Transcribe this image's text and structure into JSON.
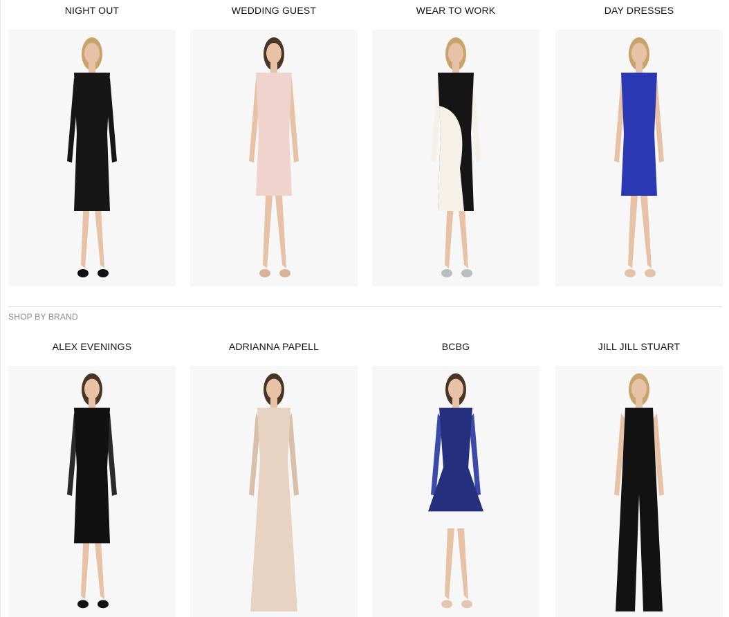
{
  "occasions": [
    {
      "label": "NIGHT OUT",
      "dress_color": "#161616",
      "accent_color": "#161616",
      "shoe_color": "#111111"
    },
    {
      "label": "WEDDING GUEST",
      "dress_color": "#efd3cc",
      "accent_color": "#f4dfd9",
      "shoe_color": "#d8b39a"
    },
    {
      "label": "WEAR TO WORK",
      "dress_color": "#151515",
      "accent_color": "#f5f1e8",
      "shoe_color": "#b7c0bc"
    },
    {
      "label": "DAY DRESSES",
      "dress_color": "#2b38b4",
      "accent_color": "#3341c2",
      "shoe_color": "#e3c3a7"
    }
  ],
  "section": {
    "heading": "SHOP BY BRAND"
  },
  "brands": [
    {
      "label": "ALEX EVENINGS",
      "dress_color": "#111111",
      "accent_color": "#2a2a2a",
      "shoe_color": "#111111"
    },
    {
      "label": "ADRIANNA PAPELL",
      "dress_color": "#e8d3c2",
      "accent_color": "#d9c0ab",
      "shoe_color": "#d9c0ab"
    },
    {
      "label": "BCBG",
      "dress_color": "#24307e",
      "accent_color": "#3b4aa8",
      "shoe_color": "#e2c6b0"
    },
    {
      "label": "JILL JILL STUART",
      "dress_color": "#121212",
      "accent_color": "#1d1d1d",
      "shoe_color": "#111111"
    }
  ],
  "colors": {
    "skin": "#e8c2a6",
    "hair_blonde": "#c9a46a",
    "hair_dark": "#4a3423",
    "tile_bg": "#f7f7f7"
  }
}
